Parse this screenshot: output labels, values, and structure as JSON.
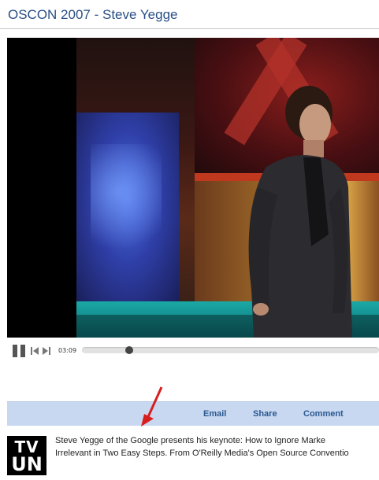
{
  "page": {
    "title": "OSCON 2007 - Steve Yegge"
  },
  "player": {
    "time": "03:09",
    "progress_fraction": 0.15,
    "controls": {
      "pause_icon": "pause-icon",
      "prev_icon": "skip-back-icon",
      "next_icon": "skip-forward-icon"
    }
  },
  "actions": {
    "email": "Email",
    "share": "Share",
    "comment": "Comment"
  },
  "logo": {
    "line1": "TV",
    "line2": "UN"
  },
  "description": {
    "line1": "Steve Yegge of the Google presents his keynote: How to Ignore Marke",
    "line2": "Irrelevant in Two Easy Steps. From O'Reilly Media's Open Source Conventio"
  },
  "colors": {
    "title": "#2a4f86",
    "action_bar": "#c8d8f0",
    "arrow": "#d81e1e"
  }
}
